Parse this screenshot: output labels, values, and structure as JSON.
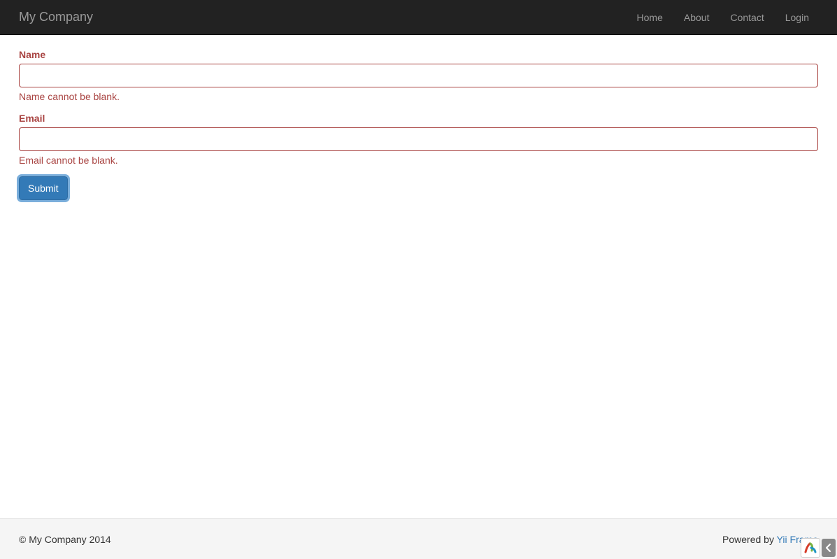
{
  "navbar": {
    "brand": "My Company",
    "links": [
      {
        "label": "Home"
      },
      {
        "label": "About"
      },
      {
        "label": "Contact"
      },
      {
        "label": "Login"
      }
    ]
  },
  "form": {
    "name": {
      "label": "Name",
      "value": "",
      "error": "Name cannot be blank."
    },
    "email": {
      "label": "Email",
      "value": "",
      "error": "Email cannot be blank."
    },
    "submit_label": "Submit"
  },
  "footer": {
    "copyright": "© My Company 2014",
    "powered_prefix": "Powered by ",
    "powered_link": "Yii Frame"
  }
}
